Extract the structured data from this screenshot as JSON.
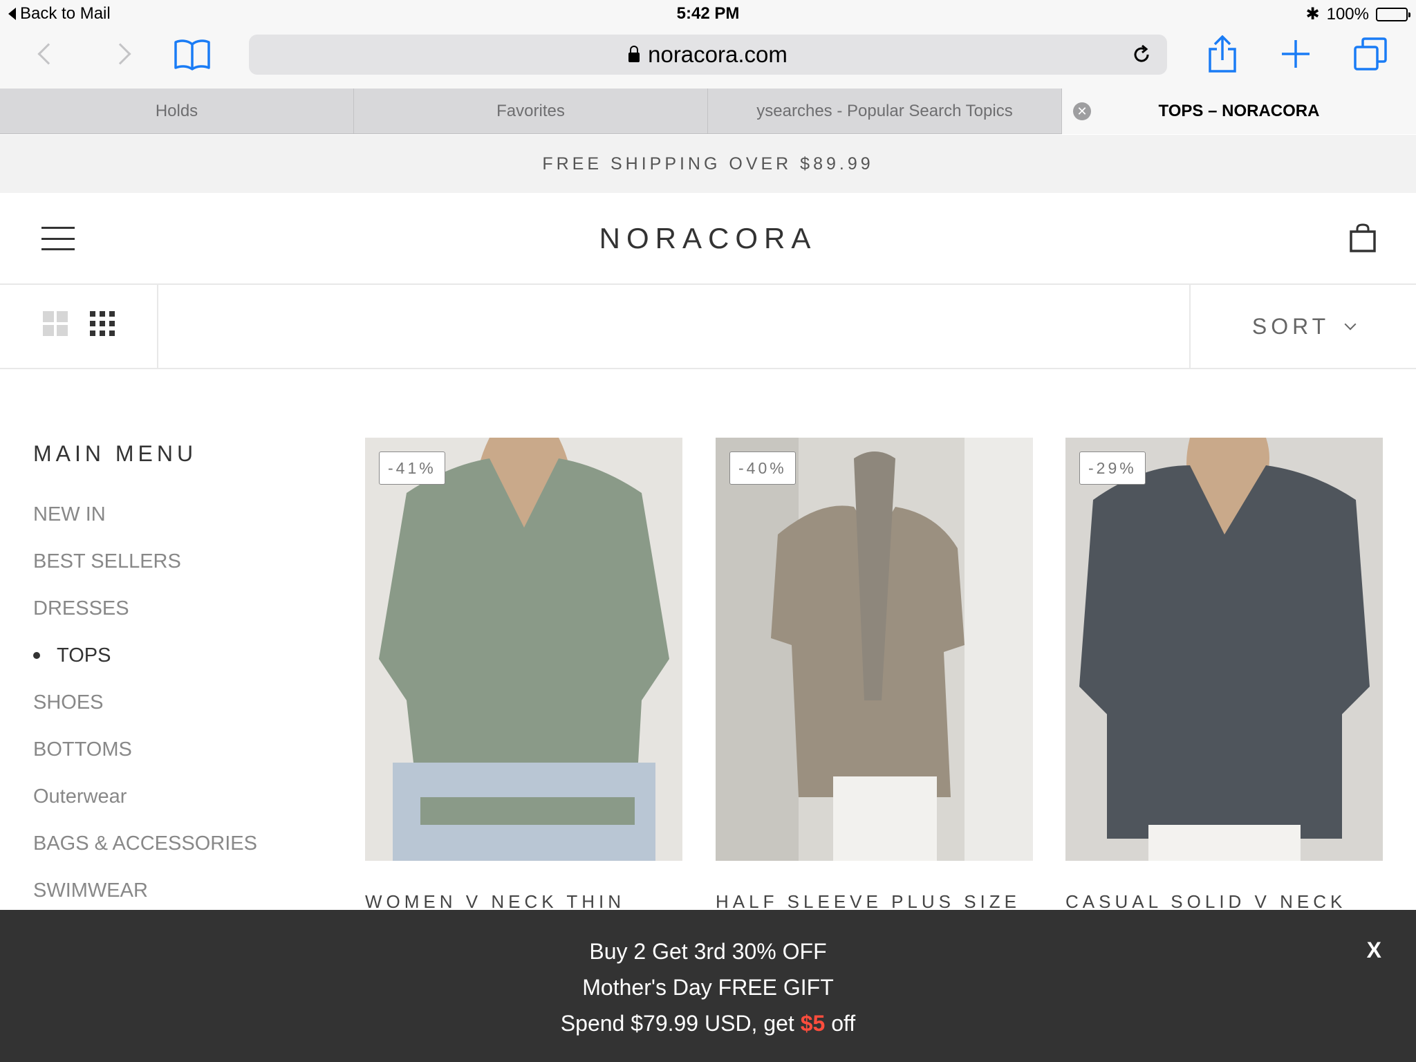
{
  "status_bar": {
    "back_label": "Back to Mail",
    "time": "5:42 PM",
    "battery": "100%"
  },
  "browser": {
    "url": "noracora.com",
    "tabs": [
      {
        "label": "Holds"
      },
      {
        "label": "Favorites"
      },
      {
        "label": "ysearches - Popular Search Topics"
      },
      {
        "label": "TOPS – NORACORA"
      }
    ]
  },
  "site": {
    "announcement": "FREE SHIPPING OVER $89.99",
    "logo": "NORACORA",
    "sort_label": "SORT",
    "main_menu": {
      "title": "MAIN MENU",
      "items": [
        {
          "label": "NEW IN"
        },
        {
          "label": "BEST SELLERS"
        },
        {
          "label": "DRESSES"
        },
        {
          "label": "TOPS"
        },
        {
          "label": "SHOES"
        },
        {
          "label": "BOTTOMS"
        },
        {
          "label": "Outerwear"
        },
        {
          "label": "BAGS & ACCESSORIES"
        },
        {
          "label": "SWIMWEAR"
        }
      ],
      "active": "TOPS"
    },
    "products": [
      {
        "discount": "-41%",
        "title": "WOMEN V NECK THIN",
        "color": "#8a9a88"
      },
      {
        "discount": "-40%",
        "title": "HALF SLEEVE PLUS SIZE",
        "color": "#9b9080"
      },
      {
        "discount": "-29%",
        "title": "CASUAL SOLID V NECK",
        "color": "#4f555c"
      }
    ]
  },
  "promo": {
    "line1": "Buy 2 Get 3rd 30% OFF",
    "line2": "Mother's Day FREE GIFT",
    "line3_prefix": "Spend $79.99 USD, get ",
    "line3_amount": "$5",
    "line3_suffix": " off",
    "close_label": "X"
  }
}
